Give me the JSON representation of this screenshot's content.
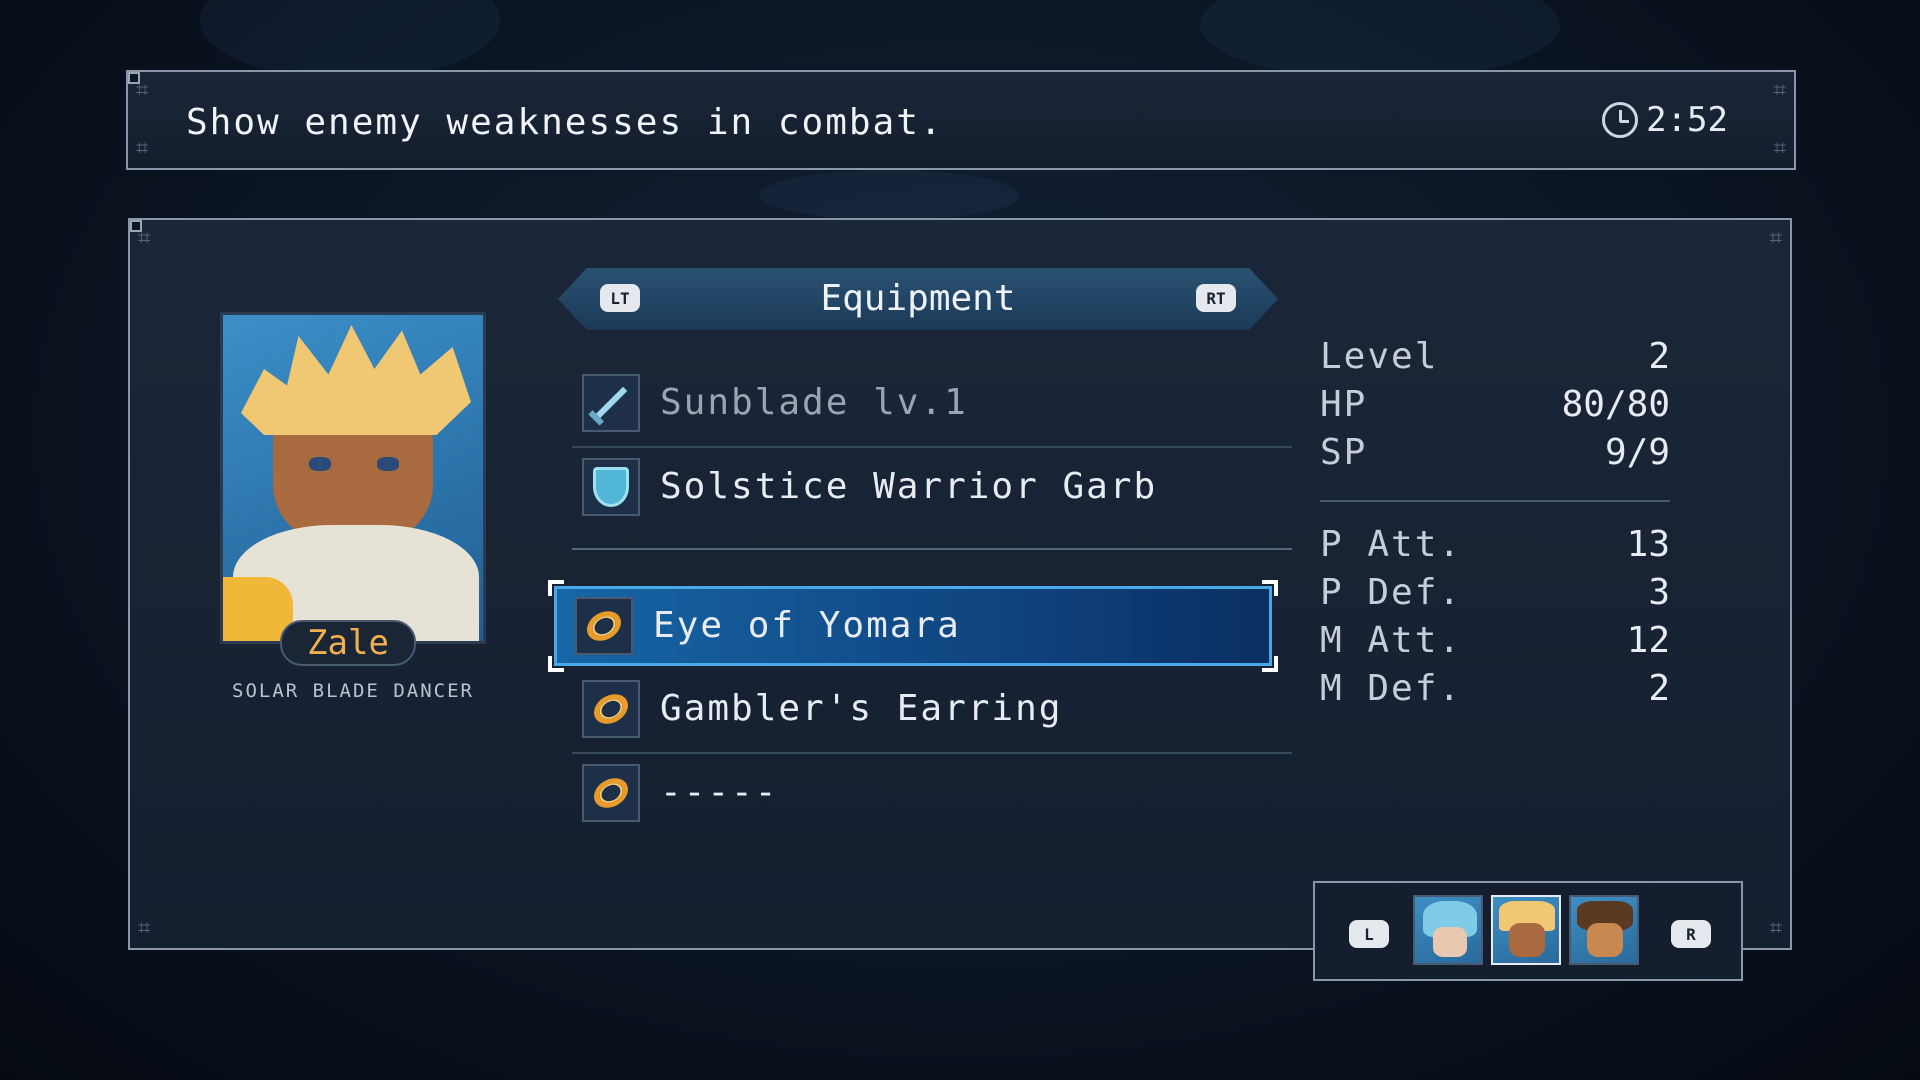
{
  "hint": {
    "text": "Show enemy weaknesses in combat.",
    "time": "2:52"
  },
  "character": {
    "name": "Zale",
    "class": "SOLAR BLADE DANCER"
  },
  "equipment": {
    "title": "Equipment",
    "prev_button": "LT",
    "next_button": "RT",
    "items": [
      {
        "slot": "weapon",
        "name": "Sunblade lv.1",
        "icon": "sword-icon"
      },
      {
        "slot": "armor",
        "name": "Solstice Warrior Garb",
        "icon": "shield-icon"
      },
      {
        "slot": "accessory",
        "name": "Eye of Yomara",
        "icon": "ring-icon",
        "selected": true
      },
      {
        "slot": "accessory",
        "name": "Gambler's Earring",
        "icon": "ring-icon"
      },
      {
        "slot": "accessory",
        "name": "-----",
        "icon": "ring-icon"
      }
    ]
  },
  "stats": {
    "level": {
      "label": "Level",
      "value": "2"
    },
    "hp": {
      "label": "HP",
      "value": "80/80"
    },
    "sp": {
      "label": "SP",
      "value": "9/9"
    },
    "p_att": {
      "label": "P Att.",
      "value": "13"
    },
    "p_def": {
      "label": "P Def.",
      "value": "3"
    },
    "m_att": {
      "label": "M Att.",
      "value": "12"
    },
    "m_def": {
      "label": "M Def.",
      "value": "2"
    }
  },
  "party": {
    "prev_button": "L",
    "next_button": "R"
  },
  "colors": {
    "selection": "#1766a6",
    "name_accent": "#f0b050",
    "ring": "#e89a2a"
  }
}
